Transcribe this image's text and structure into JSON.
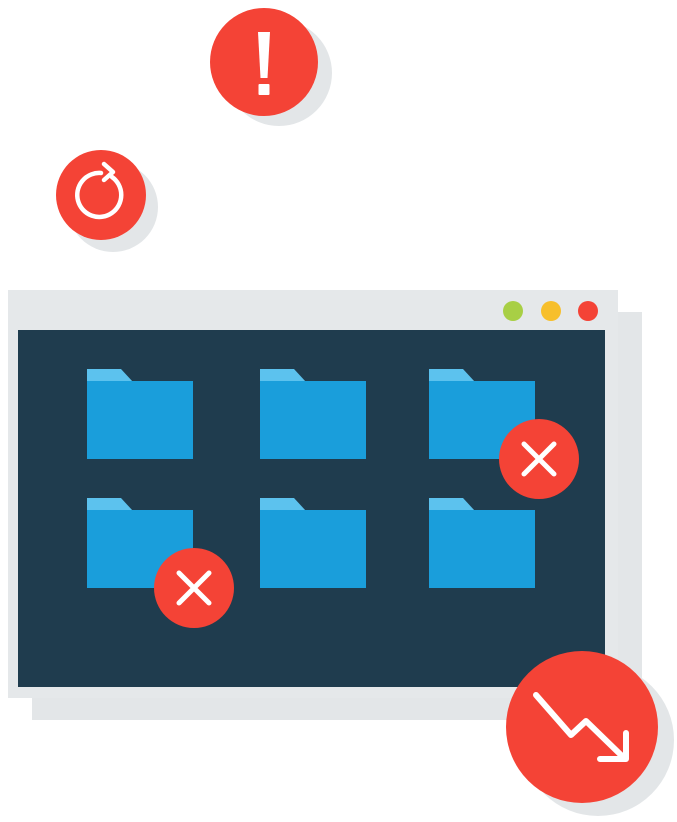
{
  "colors": {
    "alert_red": "#f44336",
    "shadow_gray": "#e3e6e8",
    "frame_gray": "#e5e8ea",
    "screen_navy": "#1f3c4e",
    "folder_body": "#1a9edb",
    "folder_tab": "#5cc2ee",
    "dot_green": "#a8cf45",
    "dot_yellow": "#f7bf2b",
    "dot_red": "#f44336",
    "white": "#ffffff"
  },
  "icons": {
    "alert": "exclamation-icon",
    "refresh": "refresh-icon",
    "error": "close-icon",
    "trend": "trending-down-icon",
    "folder": "folder-icon"
  },
  "folders": [
    {
      "row": 1,
      "col": 1,
      "has_error": false
    },
    {
      "row": 1,
      "col": 2,
      "has_error": false
    },
    {
      "row": 1,
      "col": 3,
      "has_error": true
    },
    {
      "row": 2,
      "col": 1,
      "has_error": true
    },
    {
      "row": 2,
      "col": 2,
      "has_error": false
    },
    {
      "row": 2,
      "col": 3,
      "has_error": false
    }
  ]
}
